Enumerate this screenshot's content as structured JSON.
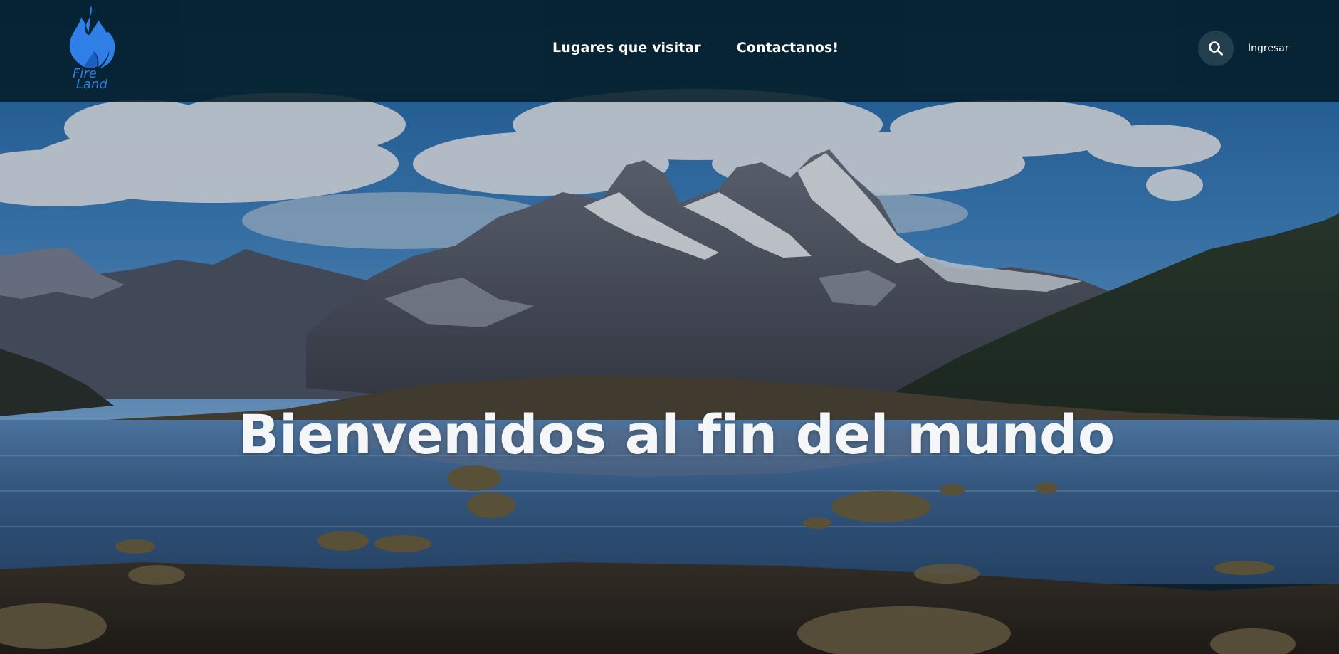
{
  "header": {
    "logo": {
      "line1": "Fire",
      "line2": "Land",
      "color": "#2f7fe6"
    },
    "nav": {
      "places_label": "Lugares que visitar",
      "contact_label": "Contactanos!"
    },
    "search_icon": "search-icon",
    "login_label": "Ingresar"
  },
  "hero": {
    "title": "Bienvenidos al fin del mundo",
    "background": "mountain-lake-landscape"
  }
}
